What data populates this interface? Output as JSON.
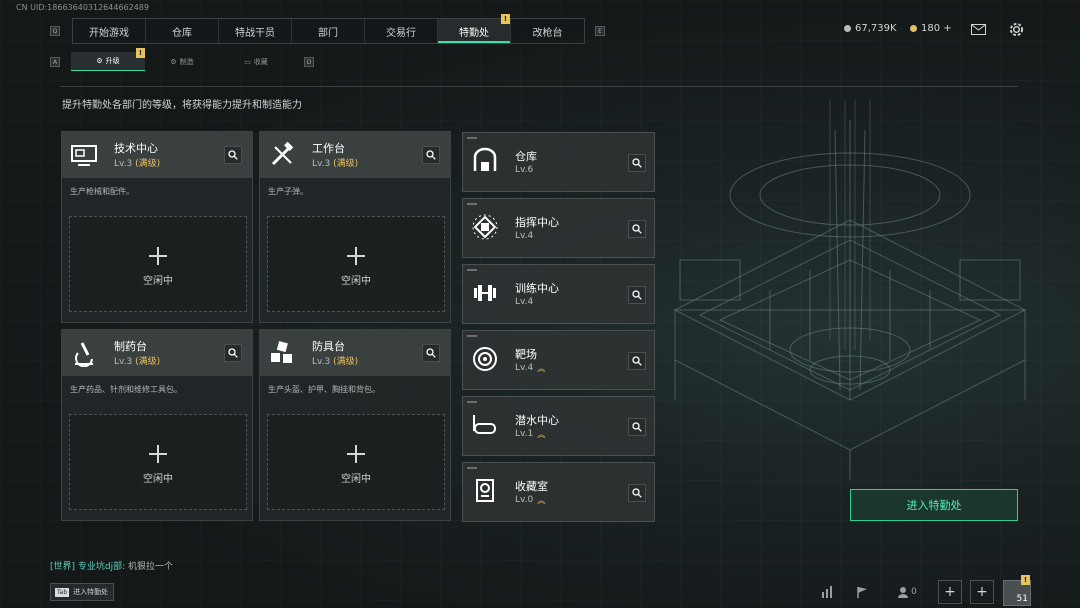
{
  "uid": "CN UID:18663640312644662489",
  "nav": {
    "key_left": "Q",
    "key_right": "E",
    "tabs": [
      {
        "label": "开始游戏"
      },
      {
        "label": "仓库"
      },
      {
        "label": "特战干员"
      },
      {
        "label": "部门"
      },
      {
        "label": "交易行"
      },
      {
        "label": "特勤处"
      },
      {
        "label": "改枪台"
      }
    ],
    "alert_badge": "!"
  },
  "currency": {
    "coins": "67,739K",
    "gold": "180 +"
  },
  "subnav": {
    "key_left": "A",
    "key_right": "D",
    "tabs": [
      {
        "label": "升级"
      },
      {
        "label": "制造"
      },
      {
        "label": "收藏"
      }
    ]
  },
  "description": "提升特勤处各部门的等级，将获得能力提升和制造能力",
  "cards": [
    {
      "title": "技术中心",
      "level": "Lv.3",
      "max": "(满级)",
      "subtitle": "生产枪械和配件。",
      "slot": "空闲中",
      "icon": "monitor-icon"
    },
    {
      "title": "工作台",
      "level": "Lv.3",
      "max": "(满级)",
      "subtitle": "生产子弹。",
      "slot": "空闲中",
      "icon": "tools-icon"
    },
    {
      "title": "制药台",
      "level": "Lv.3",
      "max": "(满级)",
      "subtitle": "生产药品、针剂和维修工具包。",
      "slot": "空闲中",
      "icon": "microscope-icon"
    },
    {
      "title": "防具台",
      "level": "Lv.3",
      "max": "(满级)",
      "subtitle": "生产头盔、护甲、胸挂和背包。",
      "slot": "空闲中",
      "icon": "cubes-icon"
    }
  ],
  "departments": [
    {
      "name": "仓库",
      "level": "Lv.6",
      "icon": "warehouse-icon",
      "upgradable": false
    },
    {
      "name": "指挥中心",
      "level": "Lv.4",
      "icon": "chip-icon",
      "upgradable": false
    },
    {
      "name": "训练中心",
      "level": "Lv.4",
      "icon": "dumbbell-icon",
      "upgradable": false
    },
    {
      "name": "靶场",
      "level": "Lv.4",
      "icon": "target-icon",
      "upgradable": true
    },
    {
      "name": "潜水中心",
      "level": "Lv.1",
      "icon": "diving-mask-icon",
      "upgradable": true
    },
    {
      "name": "收藏室",
      "level": "Lv.0",
      "icon": "trophy-icon",
      "upgradable": true
    }
  ],
  "enter_button": "进入特勤处",
  "chat": {
    "channel": "[世界]",
    "user": "专业坑dj部",
    "message": "机狠拉一个"
  },
  "tab_hint": {
    "key": "Tab",
    "label": "进入特勤处"
  },
  "bottom": {
    "friends": "0",
    "level": "51",
    "plus": "+"
  }
}
